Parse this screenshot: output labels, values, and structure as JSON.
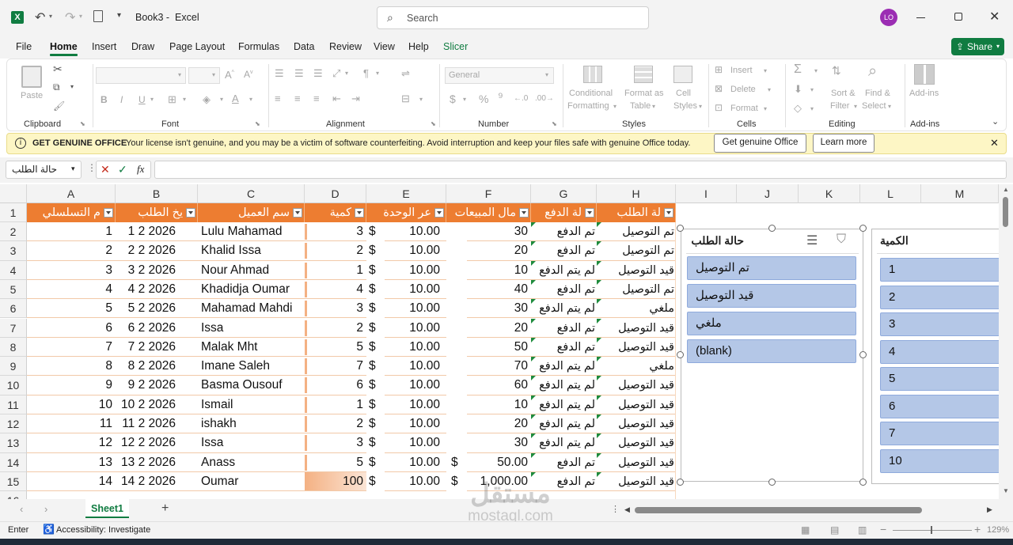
{
  "window": {
    "doc_title": "Book3",
    "app_name": "Excel",
    "search_placeholder": "Search",
    "user_initials": "LO"
  },
  "menu": [
    "File",
    "Home",
    "Insert",
    "Draw",
    "Page Layout",
    "Formulas",
    "Data",
    "Review",
    "View",
    "Help",
    "Slicer"
  ],
  "share_label": "Share",
  "ribbon": {
    "paste": "Paste",
    "font_select": "",
    "font_size": "",
    "number_format": "General",
    "cond_format": [
      "Conditional",
      "Formatting"
    ],
    "format_table": [
      "Format as",
      "Table"
    ],
    "cell_styles": [
      "Cell",
      "Styles"
    ],
    "insert": "Insert",
    "delete": "Delete",
    "format": "Format",
    "sort_filter": [
      "Sort &",
      "Filter"
    ],
    "find_select": [
      "Find &",
      "Select"
    ],
    "addins": "Add-ins",
    "groups": [
      "Clipboard",
      "Font",
      "Alignment",
      "Number",
      "Styles",
      "Cells",
      "Editing",
      "Add-ins"
    ]
  },
  "notice": {
    "title": "GET GENUINE OFFICE",
    "message": "Your license isn't genuine, and you may be a victim of software counterfeiting. Avoid interruption and keep your files safe with genuine Office today.",
    "btn_genuine": "Get genuine Office",
    "btn_learn": "Learn more"
  },
  "formula_bar": {
    "name_box": "حالة الطلب",
    "fx": "fx",
    "content": ""
  },
  "columns": [
    "A",
    "B",
    "C",
    "D",
    "E",
    "F",
    "G",
    "H",
    "I",
    "J",
    "K",
    "L",
    "M"
  ],
  "table_headers": [
    "م التسلسلي",
    "يخ الطلب",
    "سم العميل",
    "كمية",
    "عر الوحدة",
    "مال المبيعات",
    "لة الدفع",
    "لة الطلب"
  ],
  "rows": [
    {
      "n": "2",
      "seq": "1",
      "date": "1 2 2026",
      "name": "Lulu Mahamad",
      "qty": "3",
      "cur": "$",
      "price": "10.00",
      "cur2": "",
      "total": "30",
      "pay": "تم الدفع",
      "status": "تم التوصيل"
    },
    {
      "n": "3",
      "seq": "2",
      "date": "2 2 2026",
      "name": "Khalid Issa",
      "qty": "2",
      "cur": "$",
      "price": "10.00",
      "cur2": "",
      "total": "20",
      "pay": "تم الدفع",
      "status": "تم التوصيل"
    },
    {
      "n": "4",
      "seq": "3",
      "date": "3 2 2026",
      "name": "Nour Ahmad",
      "qty": "1",
      "cur": "$",
      "price": "10.00",
      "cur2": "",
      "total": "10",
      "pay": "لم يتم الدفع",
      "status": "قيد التوصيل"
    },
    {
      "n": "5",
      "seq": "4",
      "date": "4 2 2026",
      "name": "Khadidja Oumar",
      "qty": "4",
      "cur": "$",
      "price": "10.00",
      "cur2": "",
      "total": "40",
      "pay": "تم الدفع",
      "status": "تم التوصيل"
    },
    {
      "n": "6",
      "seq": "5",
      "date": "5 2 2026",
      "name": "Mahamad Mahdi",
      "qty": "3",
      "cur": "$",
      "price": "10.00",
      "cur2": "",
      "total": "30",
      "pay": "لم يتم الدفع",
      "status": "ملغي"
    },
    {
      "n": "7",
      "seq": "6",
      "date": "6 2 2026",
      "name": "Issa",
      "qty": "2",
      "cur": "$",
      "price": "10.00",
      "cur2": "",
      "total": "20",
      "pay": "تم الدفع",
      "status": "قيد التوصيل"
    },
    {
      "n": "8",
      "seq": "7",
      "date": "7 2 2026",
      "name": "Malak Mht",
      "qty": "5",
      "cur": "$",
      "price": "10.00",
      "cur2": "",
      "total": "50",
      "pay": "تم الدفع",
      "status": "قيد التوصيل"
    },
    {
      "n": "9",
      "seq": "8",
      "date": "8 2 2026",
      "name": "Imane Saleh",
      "qty": "7",
      "cur": "$",
      "price": "10.00",
      "cur2": "",
      "total": "70",
      "pay": "لم يتم الدفع",
      "status": "ملغي"
    },
    {
      "n": "10",
      "seq": "9",
      "date": "9 2 2026",
      "name": "Basma Ousouf",
      "qty": "6",
      "cur": "$",
      "price": "10.00",
      "cur2": "",
      "total": "60",
      "pay": "لم يتم الدفع",
      "status": "قيد التوصيل"
    },
    {
      "n": "11",
      "seq": "10",
      "date": "10 2 2026",
      "name": "Ismail",
      "qty": "1",
      "cur": "$",
      "price": "10.00",
      "cur2": "",
      "total": "10",
      "pay": "لم يتم الدفع",
      "status": "قيد التوصيل"
    },
    {
      "n": "12",
      "seq": "11",
      "date": "11 2 2026",
      "name": "ishakh",
      "qty": "2",
      "cur": "$",
      "price": "10.00",
      "cur2": "",
      "total": "20",
      "pay": "لم يتم الدفع",
      "status": "قيد التوصيل"
    },
    {
      "n": "13",
      "seq": "12",
      "date": "12 2 2026",
      "name": "Issa",
      "qty": "3",
      "cur": "$",
      "price": "10.00",
      "cur2": "",
      "total": "30",
      "pay": "لم يتم الدفع",
      "status": "قيد التوصيل"
    },
    {
      "n": "14",
      "seq": "13",
      "date": "13 2 2026",
      "name": "Anass",
      "qty": "5",
      "cur": "$",
      "price": "10.00",
      "cur2": "$",
      "total": "50.00",
      "pay": "تم الدفع",
      "status": "قيد التوصيل"
    },
    {
      "n": "15",
      "seq": "14",
      "date": "14 2 2026",
      "name": "Oumar",
      "qty": "100",
      "cur": "$",
      "price": "10.00",
      "cur2": "$",
      "total": "1,000.00",
      "pay": "تم الدفع",
      "status": "قيد التوصيل"
    }
  ],
  "slicer_status": {
    "title": "حالة الطلب",
    "items": [
      "تم التوصيل",
      "قيد التوصيل",
      "ملغي",
      "(blank)"
    ]
  },
  "slicer_qty": {
    "title": "الكمية",
    "items": [
      "1",
      "2",
      "3",
      "4",
      "5",
      "6",
      "7",
      "10"
    ]
  },
  "sheet_tab": "Sheet1",
  "status": {
    "mode": "Enter",
    "accessibility": "Accessibility: Investigate",
    "zoom": "129%"
  },
  "watermark": "mostaql.com",
  "colors": {
    "table_header": "#ed7d31",
    "slicer_item": "#b4c7e7",
    "excel_green": "#107c41"
  }
}
